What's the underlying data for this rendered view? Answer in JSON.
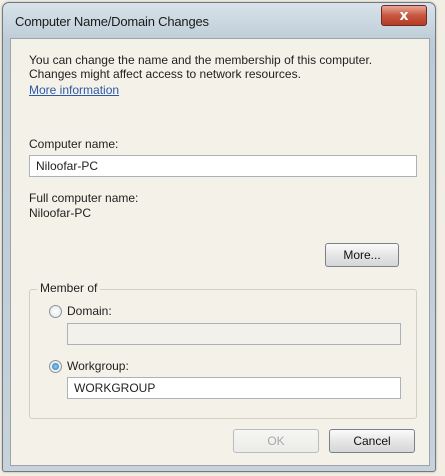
{
  "window": {
    "title": "Computer Name/Domain Changes",
    "close_icon": "close-icon",
    "close_glyph": "x"
  },
  "description": "You can change the name and the membership of this computer. Changes might affect access to network resources.",
  "more_info_link": "More information",
  "computer_name": {
    "label": "Computer name:",
    "value": "Niloofar-PC"
  },
  "full_computer_name": {
    "label": "Full computer name:",
    "value": "Niloofar-PC"
  },
  "more_button": "More...",
  "member_of": {
    "legend": "Member of",
    "domain": {
      "label": "Domain:",
      "value": "",
      "checked": false
    },
    "workgroup": {
      "label": "Workgroup:",
      "value": "WORKGROUP",
      "checked": true
    }
  },
  "buttons": {
    "ok": "OK",
    "cancel": "Cancel"
  },
  "colors": {
    "title_bar": "#c7d2da",
    "close_button": "#c8563f",
    "link": "#2c5aa8",
    "dialog_background": "#f4f1e8"
  }
}
